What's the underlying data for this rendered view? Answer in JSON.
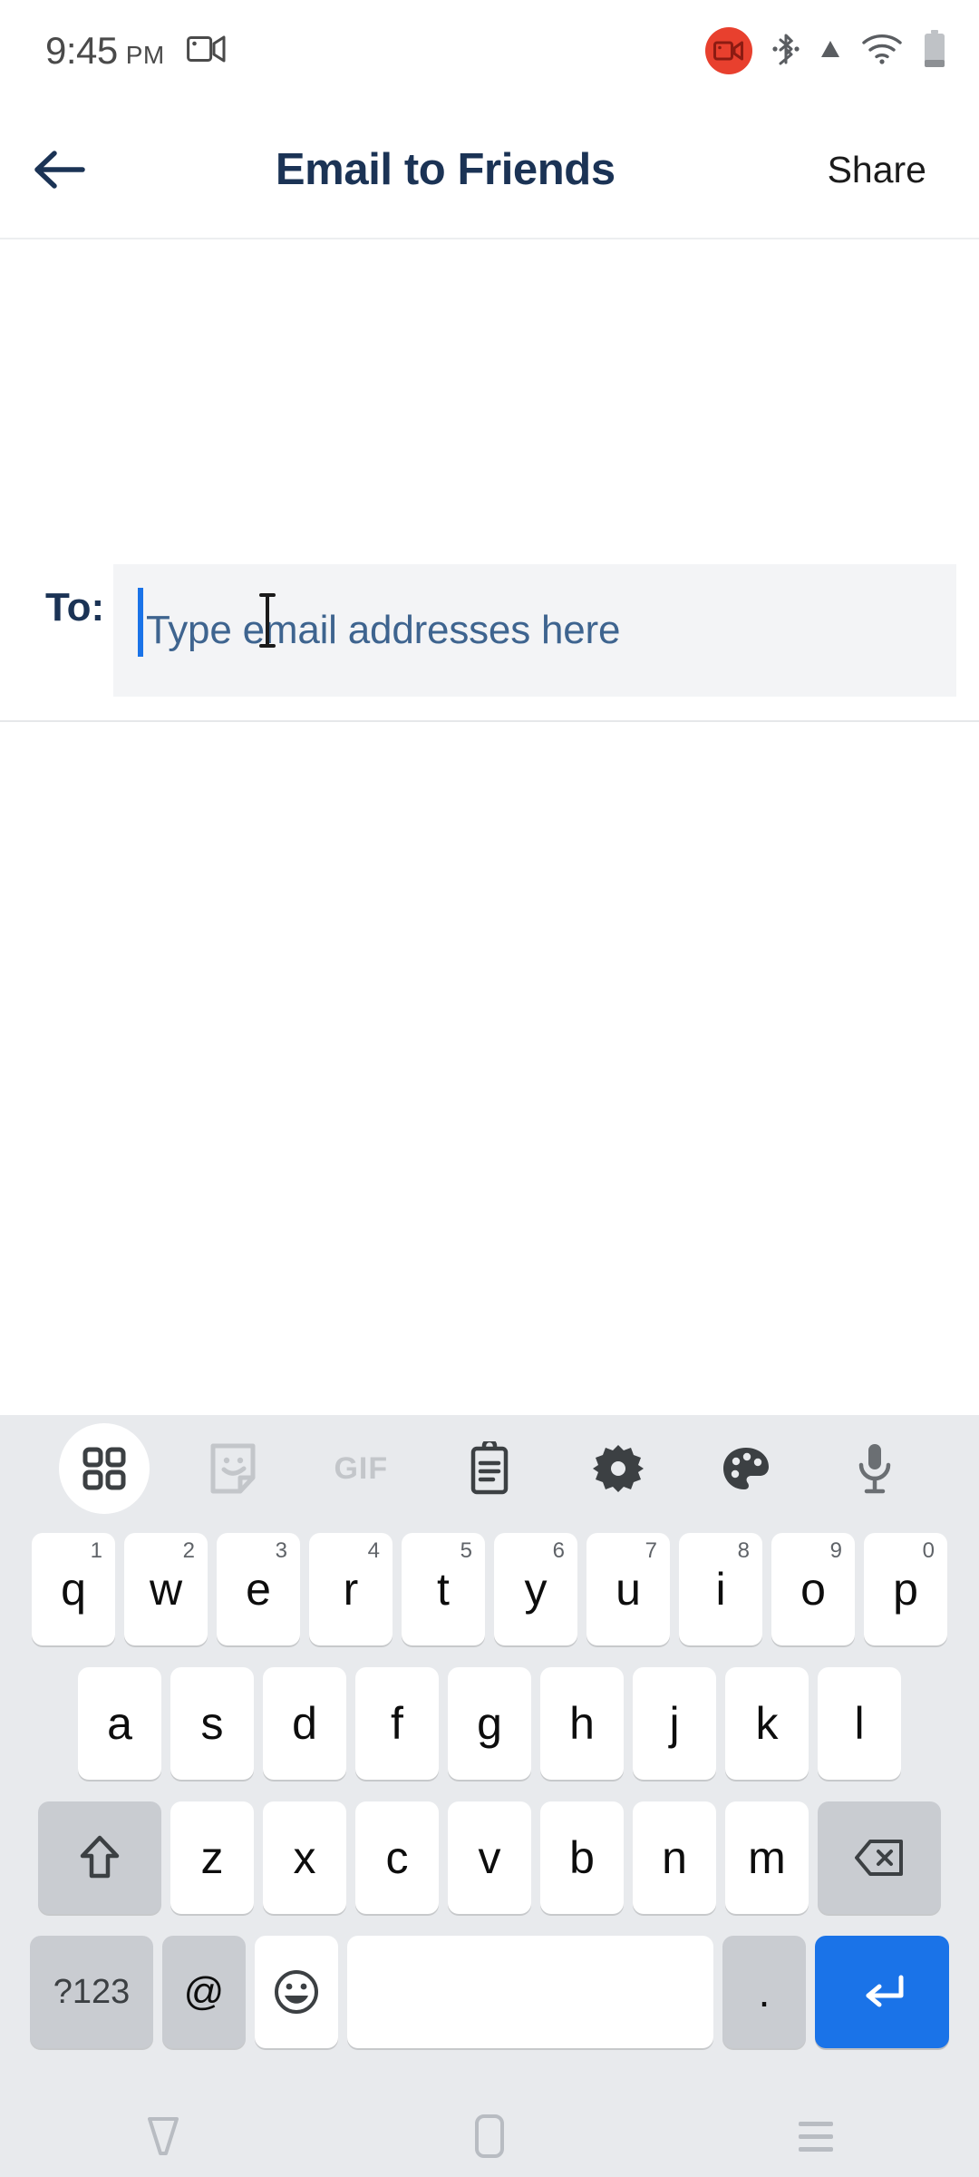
{
  "status_bar": {
    "time": "9:45",
    "ampm": "PM",
    "icons": [
      {
        "name": "screen-record-icon",
        "label": "screen recording"
      },
      {
        "name": "screen-record-badge-icon",
        "label": "recording active"
      },
      {
        "name": "bluetooth-icon",
        "label": "bluetooth"
      },
      {
        "name": "signal-triangle-icon",
        "label": "cellular signal"
      },
      {
        "name": "wifi-icon",
        "label": "wifi"
      },
      {
        "name": "battery-icon",
        "label": "battery"
      }
    ]
  },
  "app_bar": {
    "back_label": "back",
    "title": "Email to Friends",
    "share_label": "Share"
  },
  "compose": {
    "to_label": "To:",
    "to_value": "",
    "to_placeholder": "Type email addresses here"
  },
  "keyboard": {
    "toolbar": [
      {
        "name": "grid-icon",
        "label": "Toolbox",
        "active": true
      },
      {
        "name": "sticker-icon",
        "label": "Stickers",
        "active": false
      },
      {
        "name": "gif-icon",
        "label": "GIF",
        "active": false
      },
      {
        "name": "clipboard-icon",
        "label": "Clipboard",
        "active": false
      },
      {
        "name": "gear-icon",
        "label": "Settings",
        "active": false
      },
      {
        "name": "palette-icon",
        "label": "Themes",
        "active": false
      },
      {
        "name": "microphone-icon",
        "label": "Voice input",
        "active": false
      }
    ],
    "row1": [
      {
        "key": "q",
        "sup": "1"
      },
      {
        "key": "w",
        "sup": "2"
      },
      {
        "key": "e",
        "sup": "3"
      },
      {
        "key": "r",
        "sup": "4"
      },
      {
        "key": "t",
        "sup": "5"
      },
      {
        "key": "y",
        "sup": "6"
      },
      {
        "key": "u",
        "sup": "7"
      },
      {
        "key": "i",
        "sup": "8"
      },
      {
        "key": "o",
        "sup": "9"
      },
      {
        "key": "p",
        "sup": "0"
      }
    ],
    "row2": [
      {
        "key": "a"
      },
      {
        "key": "s"
      },
      {
        "key": "d"
      },
      {
        "key": "f"
      },
      {
        "key": "g"
      },
      {
        "key": "h"
      },
      {
        "key": "j"
      },
      {
        "key": "k"
      },
      {
        "key": "l"
      }
    ],
    "row3": [
      {
        "key": "z"
      },
      {
        "key": "x"
      },
      {
        "key": "c"
      },
      {
        "key": "v"
      },
      {
        "key": "b"
      },
      {
        "key": "n"
      },
      {
        "key": "m"
      }
    ],
    "shift_label": "shift",
    "backspace_label": "backspace",
    "row4": {
      "numeric_label": "?123",
      "at_label": "@",
      "emoji_label": "emoji",
      "space_label": "",
      "period_label": ".",
      "enter_label": "enter"
    }
  },
  "nav_bar": {
    "back_label": "back",
    "home_label": "home",
    "recents_label": "recent apps"
  },
  "colors": {
    "accent_blue": "#1a73e8",
    "title_navy": "#1b3355",
    "placeholder_blue": "#3e648f",
    "field_bg": "#f3f4f6",
    "keyboard_bg": "#e8eaed",
    "key_white": "#ffffff",
    "key_gray": "#c9ccd1",
    "record_red": "#e8402e"
  }
}
